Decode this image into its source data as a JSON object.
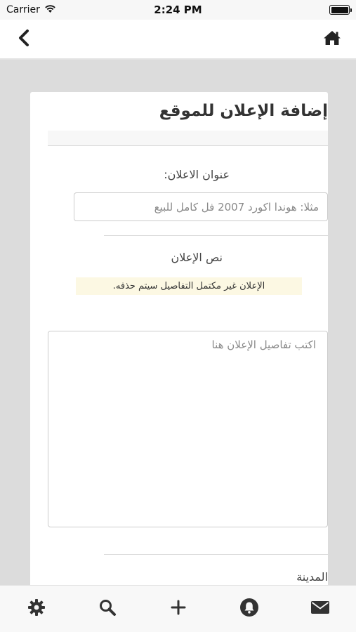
{
  "status_bar": {
    "carrier": "Carrier",
    "time": "2:24 PM"
  },
  "nav": {
    "back_icon": "chevron-left-icon",
    "home_icon": "home-icon"
  },
  "form": {
    "title": "إضافة الإعلان للموقع",
    "ad_title_label": "عنوان الاعلان:",
    "ad_title_placeholder": "مثلا: هوندا اكورد 2007 فل كامل للبيع",
    "ad_body_label": "نص الإعلان",
    "warning": "الإعلان غير مكتمل التفاصيل سيتم حذفه.",
    "ad_body_placeholder": "اكتب تفاصيل الإعلان هنا",
    "city_label": "المدينة"
  },
  "tab_bar": {
    "items": [
      {
        "icon": "gear-icon"
      },
      {
        "icon": "search-icon"
      },
      {
        "icon": "plus-icon"
      },
      {
        "icon": "bell-icon"
      },
      {
        "icon": "envelope-icon"
      }
    ]
  },
  "colors": {
    "background": "#dcdcdc",
    "card": "#ffffff",
    "warning_bg": "#fcf8e3",
    "icon": "#333333"
  }
}
